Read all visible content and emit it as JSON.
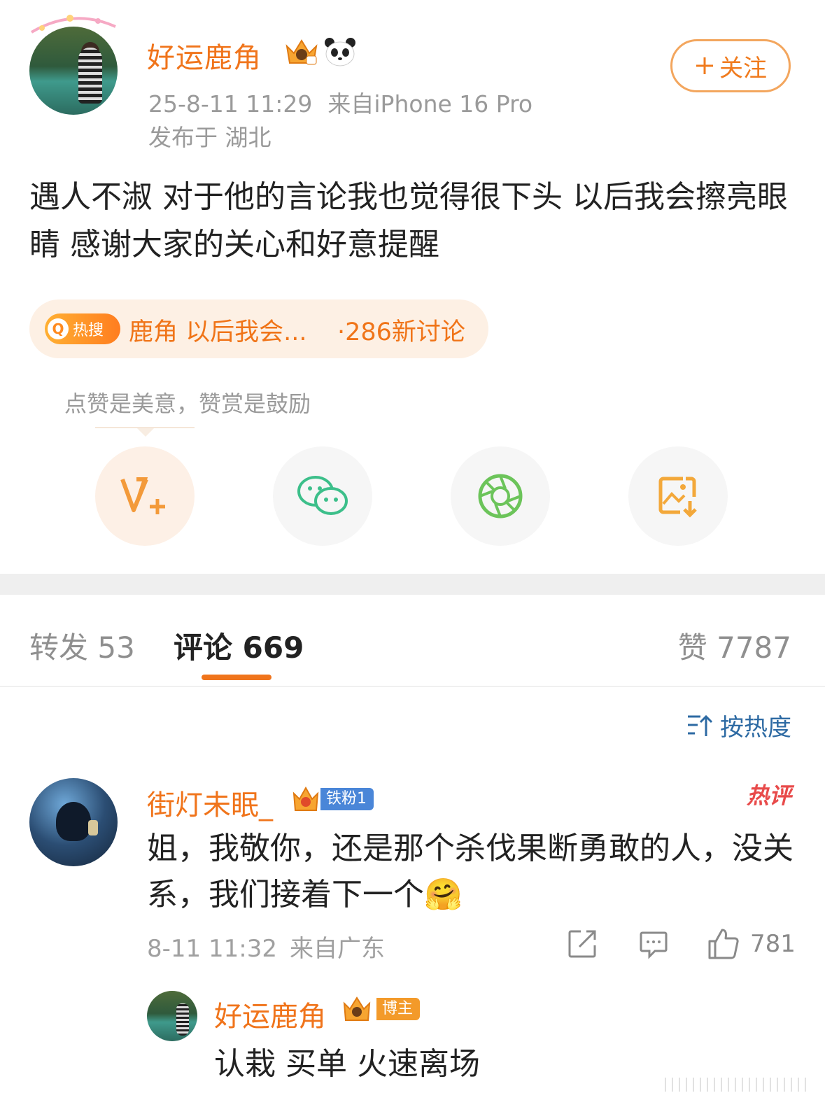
{
  "post": {
    "username": "好运鹿角",
    "follow_label": "关注",
    "timestamp": "25-8-11 11:29",
    "source": "来自iPhone 16 Pro",
    "location": "发布于 湖北",
    "content": "遇人不淑 对于他的言论我也觉得很下头 以后我会擦亮眼睛 感谢大家的关心和好意提醒"
  },
  "hot_search": {
    "badge": "热搜",
    "title": "鹿角 以后我会...",
    "count": "·286新讨论"
  },
  "reward_tip": "点赞是美意，赞赏是鼓励",
  "share_icons": [
    "reward-v-plus-icon",
    "wechat-icon",
    "moments-icon",
    "save-image-icon"
  ],
  "tabs": {
    "repost": "转发 53",
    "comment": "评论 669",
    "like": "赞 7787"
  },
  "sort_label": "按热度",
  "comment": {
    "username": "街灯未眠_",
    "fan_badge": "铁粉1",
    "hot_label": "热评",
    "text": "姐，我敬你，还是那个杀伐果断勇敢的人，没关系，我们接着下一个🤗",
    "timestamp": "8-11 11:32",
    "location": "来自广东",
    "likes": "781"
  },
  "reply": {
    "username": "好运鹿角",
    "badge": "博主",
    "text": "认栽 买单 火速离场"
  },
  "colors": {
    "accent": "#f0741b",
    "link": "#2d6aa3",
    "hot_red": "#e84a4a"
  }
}
